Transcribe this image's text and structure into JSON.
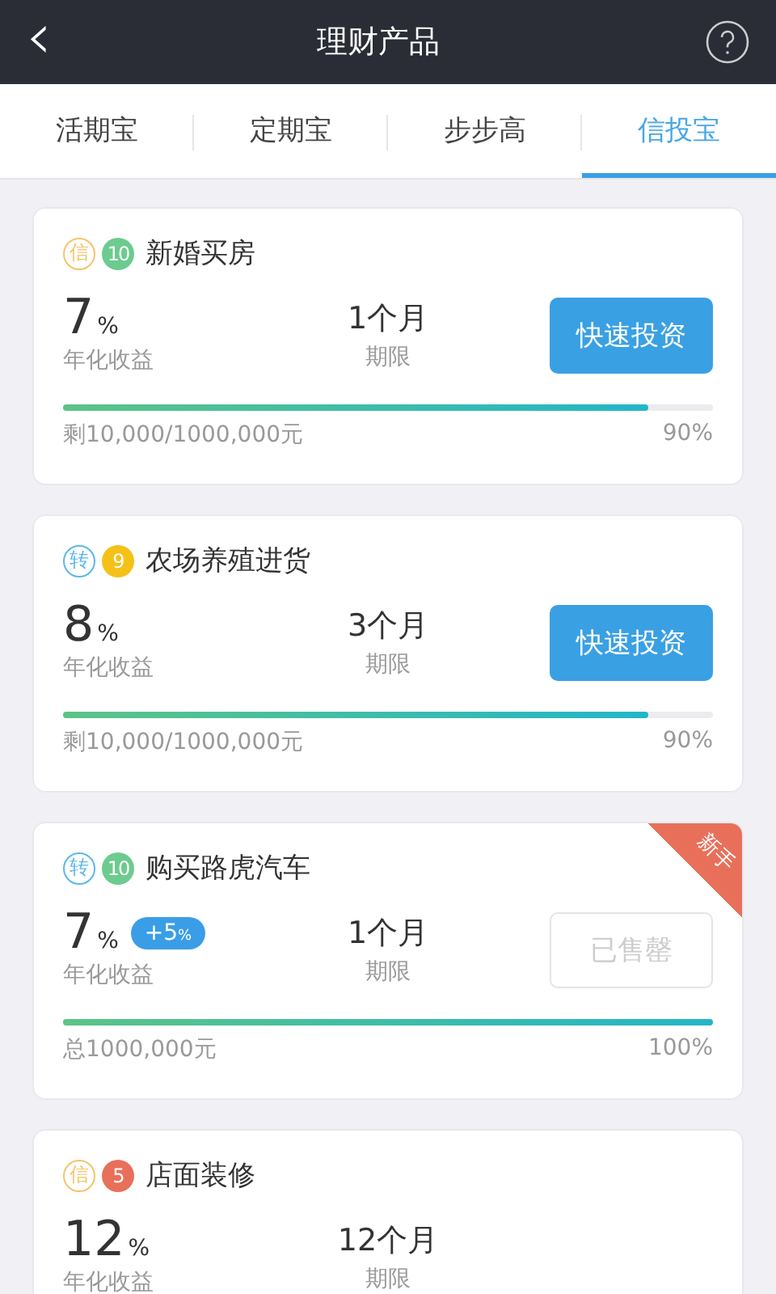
{
  "header": {
    "title": "理财产品",
    "back": "‹"
  },
  "tabs": [
    {
      "label": "活期宝",
      "selected": false
    },
    {
      "label": "定期宝",
      "selected": false
    },
    {
      "label": "步步高",
      "selected": false
    },
    {
      "label": "信投宝",
      "selected": true
    }
  ],
  "products": [
    {
      "tag": {
        "label": "信",
        "color": "#f5c46a"
      },
      "rank": {
        "label": "10",
        "color": "#6ccb8e"
      },
      "name": "新婚买房",
      "rate": "7",
      "rate_unit": "%",
      "rate_label": "年化收益",
      "term": "1个月",
      "term_label": "期限",
      "button": {
        "label": "快速投资",
        "disabled": false
      },
      "level": 0.9,
      "remaining": "剩10,000/1000,000元",
      "percent": "90%"
    },
    {
      "tag": {
        "label": "转",
        "color": "#5bb8ea"
      },
      "rank": {
        "label": "9",
        "color": "#f5c118"
      },
      "name": "农场养殖进货",
      "rate": "8",
      "rate_unit": "%",
      "rate_label": "年化收益",
      "term": "3个月",
      "term_label": "期限",
      "button": {
        "label": "快速投资",
        "disabled": false
      },
      "level": 0.9,
      "remaining": "剩10,000/1000,000元",
      "percent": "90%"
    },
    {
      "tag": {
        "label": "转",
        "color": "#5bb8ea"
      },
      "rank": {
        "label": "10",
        "color": "#6ccb8e"
      },
      "name": "购买路虎汽车",
      "rate": "7",
      "rate_unit": "%",
      "bonus": "+5",
      "bonus_unit": "%",
      "rate_label": "年化收益",
      "term": "1个月",
      "term_label": "期限",
      "button": {
        "label": "已售罄",
        "disabled": true
      },
      "level": 1,
      "remaining": "总1000,000元",
      "percent": "100%",
      "ribbon": "新手"
    },
    {
      "tag": {
        "label": "信",
        "color": "#f5c46a"
      },
      "rank": {
        "label": "5",
        "color": "#e8705a"
      },
      "name": "店面装修",
      "rate": "12",
      "rate_unit": "%",
      "rate_label": "年化收益",
      "term": "12个月",
      "term_label": "期限"
    }
  ]
}
